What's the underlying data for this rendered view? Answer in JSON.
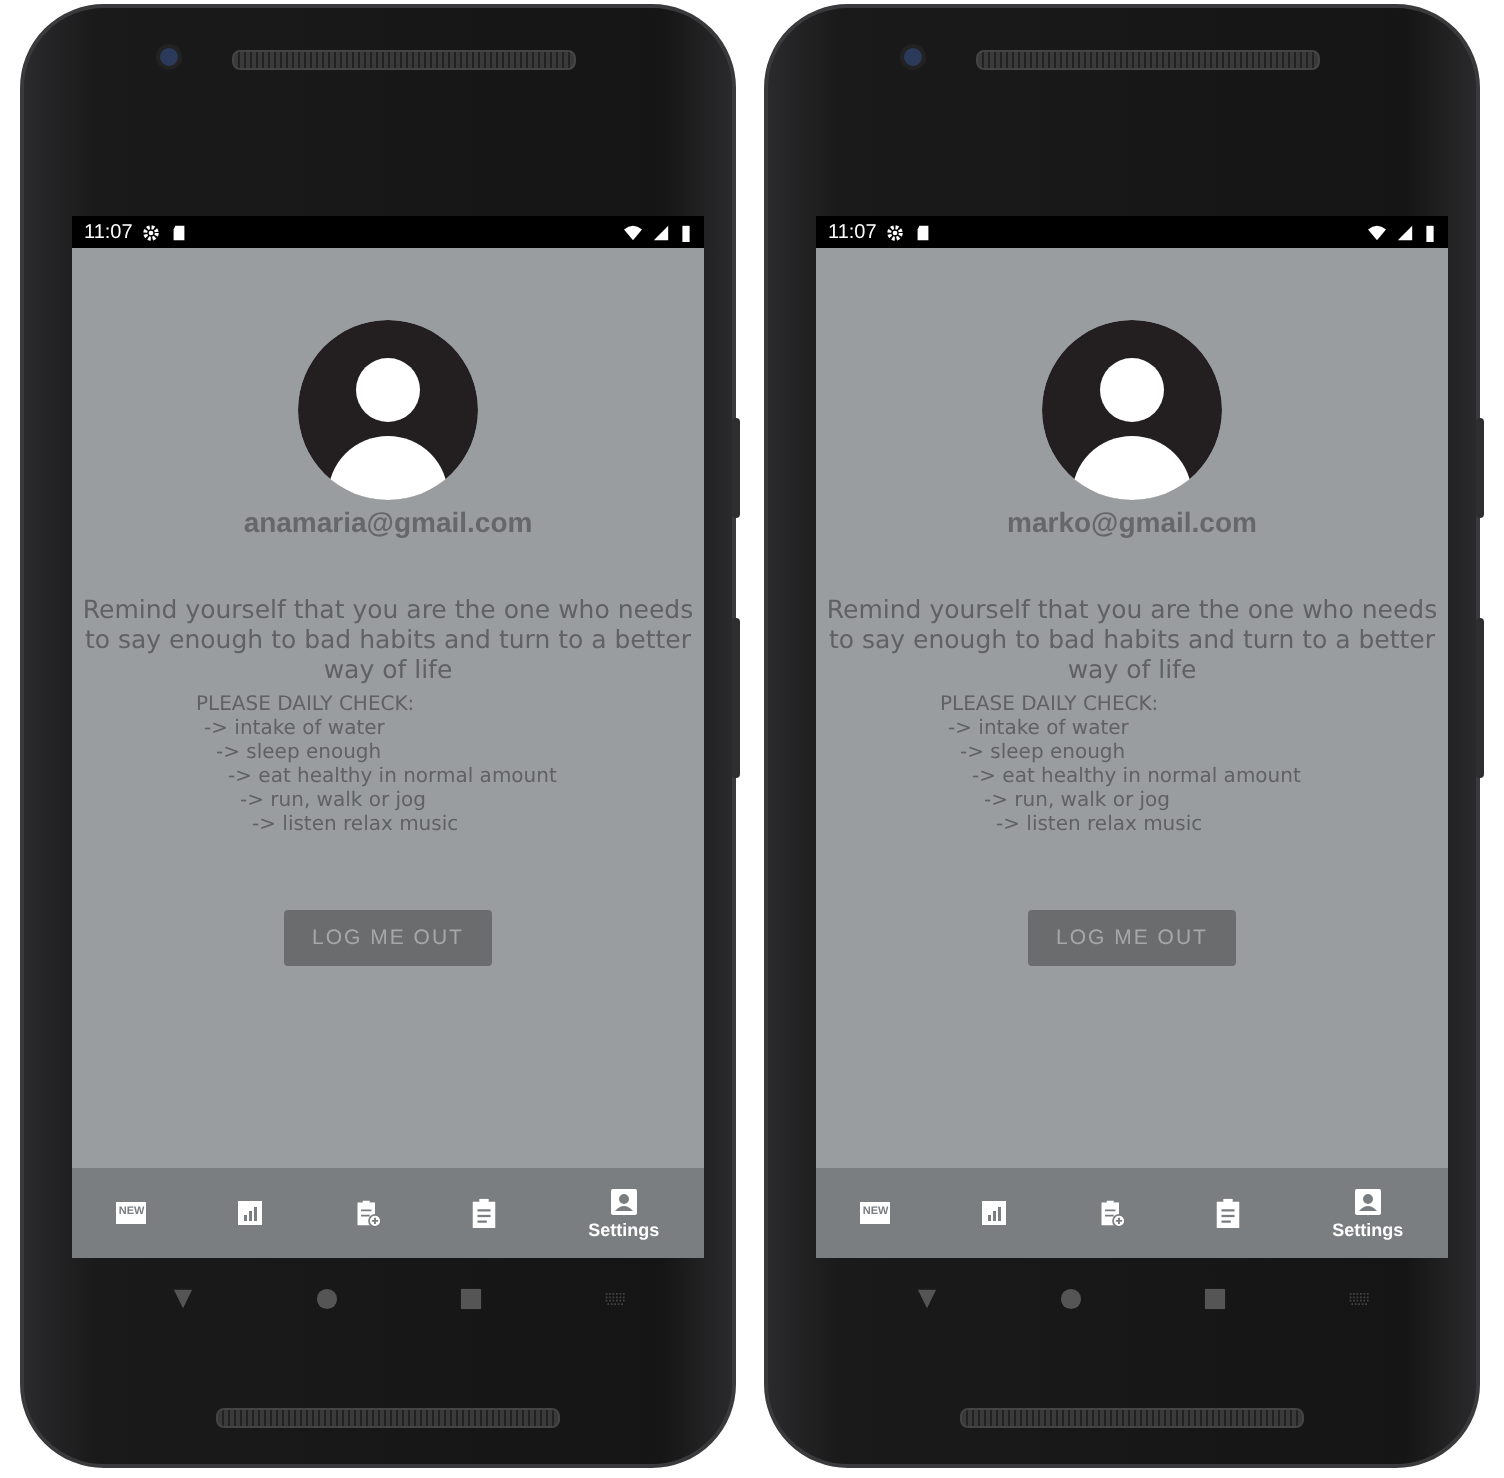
{
  "phones": [
    {
      "status_bar": {
        "time": "11:07"
      },
      "email": "anamaria@gmail.com",
      "motto": "Remind yourself that you are the one who needs to say enough to bad habits and turn to a better way of life",
      "checklist": {
        "heading": "PLEASE DAILY CHECK:",
        "items": [
          "-> intake of water",
          "-> sleep enough",
          "-> eat healthy in normal amount",
          "-> run, walk or jog",
          "-> listen relax music"
        ]
      },
      "logout_button": "LOG ME OUT",
      "bottom_nav": [
        {
          "kind": "new",
          "icon_text": "NEW",
          "selected": false
        },
        {
          "kind": "chart",
          "selected": false
        },
        {
          "kind": "clipboard-add",
          "selected": false
        },
        {
          "kind": "clipboard",
          "selected": false
        },
        {
          "kind": "person",
          "label": "Settings",
          "selected": true
        }
      ]
    },
    {
      "status_bar": {
        "time": "11:07"
      },
      "email": "marko@gmail.com",
      "motto": "Remind yourself that you are the one who needs to say enough to bad habits and turn to a better way of life",
      "checklist": {
        "heading": "PLEASE DAILY CHECK:",
        "items": [
          "-> intake of water",
          "-> sleep enough",
          "-> eat healthy in normal amount",
          "-> run, walk or jog",
          "-> listen relax music"
        ]
      },
      "logout_button": "LOG ME OUT",
      "bottom_nav": [
        {
          "kind": "new",
          "icon_text": "NEW",
          "selected": false
        },
        {
          "kind": "chart",
          "selected": false
        },
        {
          "kind": "clipboard-add",
          "selected": false
        },
        {
          "kind": "clipboard",
          "selected": false
        },
        {
          "kind": "person",
          "label": "Settings",
          "selected": true
        }
      ]
    }
  ]
}
